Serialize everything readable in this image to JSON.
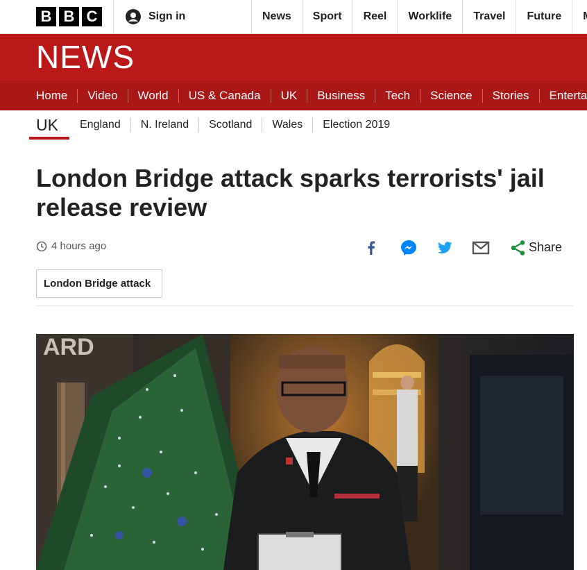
{
  "masthead": {
    "logo_letters": [
      "B",
      "B",
      "C"
    ],
    "signin_label": "Sign in",
    "signin_icon": "user-icon"
  },
  "topnav": [
    "News",
    "Sport",
    "Reel",
    "Worklife",
    "Travel",
    "Future",
    "Mo"
  ],
  "news_banner": {
    "title": "NEWS"
  },
  "section_nav": [
    "Home",
    "Video",
    "World",
    "US & Canada",
    "UK",
    "Business",
    "Tech",
    "Science",
    "Stories",
    "Enterta"
  ],
  "section_nav_active": "UK",
  "sub_nav": {
    "current": "UK",
    "items": [
      "England",
      "N. Ireland",
      "Scotland",
      "Wales",
      "Election 2019"
    ]
  },
  "article": {
    "headline": "London Bridge attack sparks terrorists' jail release review",
    "timestamp": "4 hours ago",
    "share_label": "Share",
    "share_icons": [
      "facebook-icon",
      "messenger-icon",
      "twitter-icon",
      "email-icon",
      "share-icon"
    ],
    "tag": "London Bridge attack",
    "photo_signage": "ARD"
  },
  "colors": {
    "brand_red": "#bb1919",
    "nav_red": "#a91717",
    "facebook": "#3b5998",
    "messenger": "#0084ff",
    "twitter": "#1da1f2",
    "share_green": "#1a8f3c"
  }
}
